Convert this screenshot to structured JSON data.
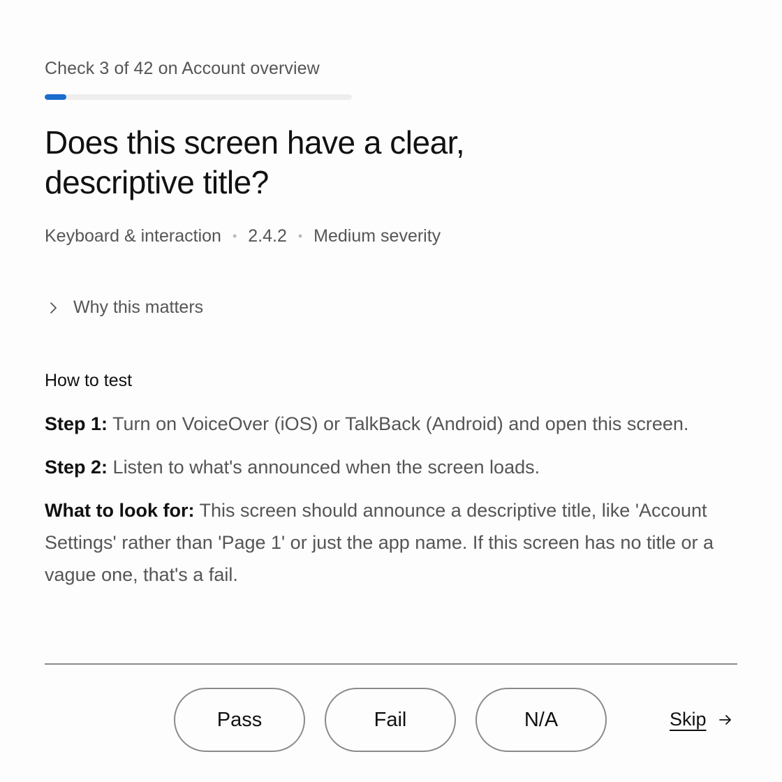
{
  "header": {
    "progress_label": "Check 3 of 42 on Account overview",
    "progress_fraction": 0.0714,
    "accent_color": "#1a6dcc"
  },
  "question": {
    "title": "Does this screen have a clear, descriptive title?"
  },
  "meta": {
    "category": "Keyboard & interaction",
    "criterion": "2.4.2",
    "severity": "Medium severity"
  },
  "why": {
    "label": "Why this matters",
    "icon": "chevron-right-icon"
  },
  "how_to_test": {
    "heading": "How to test",
    "steps": [
      {
        "label": "Step 1:",
        "text": "Turn on VoiceOver (iOS) or TalkBack (Android) and open this screen."
      },
      {
        "label": "Step 2:",
        "text": "Listen to what's announced when the screen loads."
      },
      {
        "label": "What to look for:",
        "text": "This screen should announce a descriptive title, like 'Account Settings' rather than 'Page 1' or just the app name. If this screen has no title or a vague one, that's a fail."
      }
    ]
  },
  "actions": {
    "pass_label": "Pass",
    "fail_label": "Fail",
    "na_label": "N/A",
    "skip_label": "Skip",
    "skip_icon": "arrow-right-icon"
  }
}
